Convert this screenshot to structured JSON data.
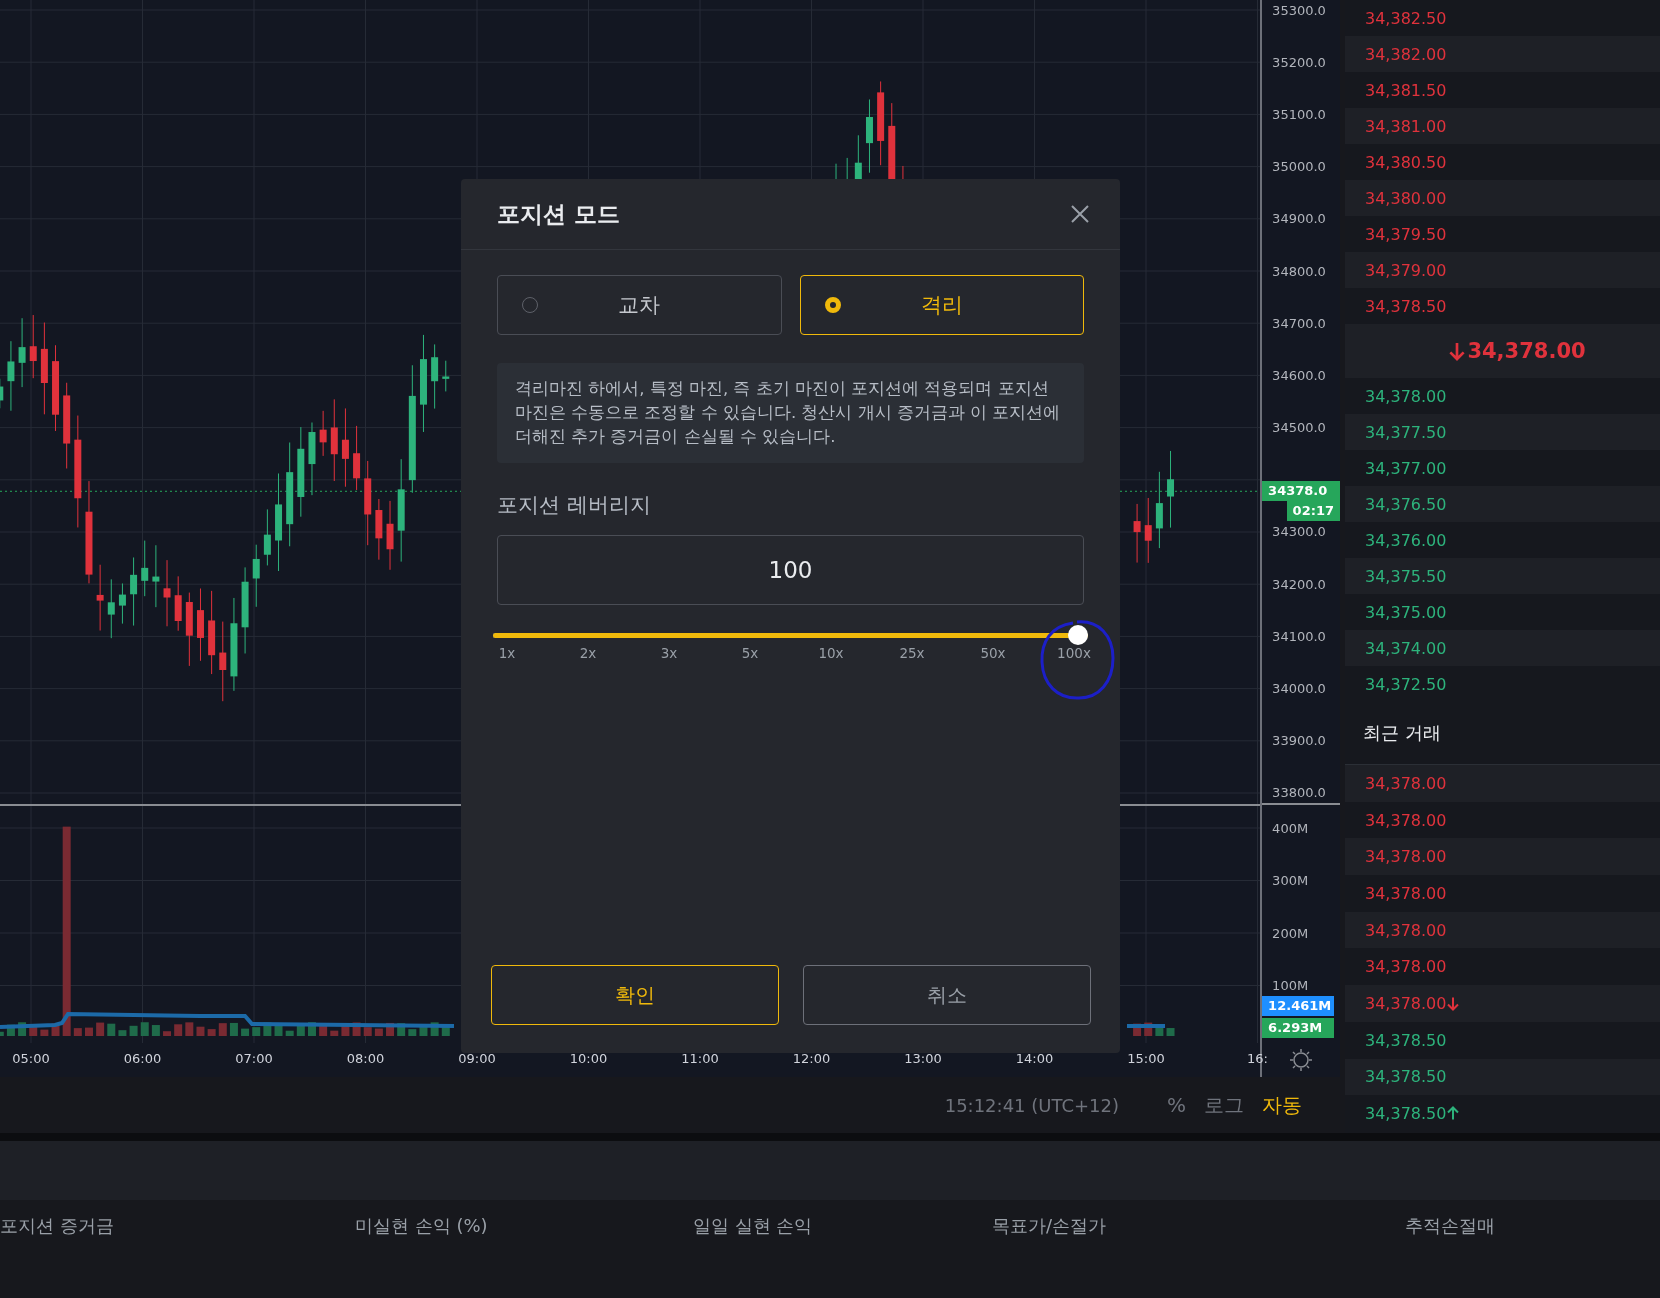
{
  "chart": {
    "price_axis_upper": [
      "35300.0",
      "35200.0",
      "35100.0",
      "35000.0",
      "34900.0",
      "34800.0",
      "34700.0",
      "34600.0",
      "34500.0"
    ],
    "price_axis_lower": [
      "34300.0",
      "34200.0",
      "34100.0",
      "34000.0",
      "33900.0",
      "33800.0"
    ],
    "current_price_tag": "34378.0",
    "countdown_tag": "02:17",
    "volume_axis": [
      "400M",
      "300M",
      "200M",
      "100M"
    ],
    "volume_tags": [
      {
        "text": "12.461M",
        "color": "#1e8fff"
      },
      {
        "text": "6.293M",
        "color": "#26a65b"
      }
    ],
    "time_axis": [
      "05:00",
      "06:00",
      "07:00",
      "08:00",
      "09:00",
      "10:00",
      "11:00",
      "12:00",
      "13:00",
      "14:00",
      "15:00",
      "16:"
    ],
    "status": {
      "time": "15:12:41 (UTC+12)",
      "scale_options": [
        {
          "label": "%",
          "selected": false
        },
        {
          "label": "로그",
          "selected": false
        },
        {
          "label": "자동",
          "selected": true
        }
      ]
    }
  },
  "order_book": {
    "asks": [
      "34,382.50",
      "34,382.00",
      "34,381.50",
      "34,381.00",
      "34,380.50",
      "34,380.00",
      "34,379.50",
      "34,379.00",
      "34,378.50"
    ],
    "last_price": {
      "text": "34,378.00",
      "falling": true
    },
    "bids": [
      "34,378.00",
      "34,377.50",
      "34,377.00",
      "34,376.50",
      "34,376.00",
      "34,375.50",
      "34,375.00",
      "34,374.00",
      "34,372.50"
    ]
  },
  "recent_trades": {
    "title": "최근 거래",
    "rows": [
      {
        "price": "34,378.00",
        "kind": "sell",
        "arrow": false
      },
      {
        "price": "34,378.00",
        "kind": "sell",
        "arrow": false
      },
      {
        "price": "34,378.00",
        "kind": "sell",
        "arrow": false
      },
      {
        "price": "34,378.00",
        "kind": "sell",
        "arrow": false
      },
      {
        "price": "34,378.00",
        "kind": "sell",
        "arrow": false
      },
      {
        "price": "34,378.00",
        "kind": "sell",
        "arrow": false
      },
      {
        "price": "34,378.00",
        "kind": "sell",
        "arrow": true
      },
      {
        "price": "34,378.50",
        "kind": "buy",
        "arrow": false
      },
      {
        "price": "34,378.50",
        "kind": "buy",
        "arrow": false
      },
      {
        "price": "34,378.50",
        "kind": "buy",
        "arrow": true
      }
    ]
  },
  "positions": {
    "columns": [
      "포지션 증거금",
      "미실현 손익 (%)",
      "일일 실현 손익",
      "목표가/손절가",
      "추적손절매"
    ]
  },
  "modal": {
    "title": "포지션 모드",
    "modes": [
      {
        "label": "교차",
        "selected": false
      },
      {
        "label": "격리",
        "selected": true
      }
    ],
    "description": "격리마진 하에서, 특정 마진, 즉 초기 마진이 포지션에 적용되며 포지션 마진은 수동으로 조정할 수 있습니다. 청산시 개시 증거금과 이 포지션에 더해진 추가 증거금이 손실될 수 있습니다.",
    "leverage": {
      "label": "포지션 레버리지",
      "value": "100",
      "level": 1,
      "marks": [
        "1x",
        "2x",
        "3x",
        "5x",
        "10x",
        "25x",
        "50x",
        "100x"
      ]
    },
    "buttons": [
      {
        "label": "확인",
        "kind": "primary"
      },
      {
        "label": "취소",
        "kind": "secondary"
      }
    ]
  }
}
